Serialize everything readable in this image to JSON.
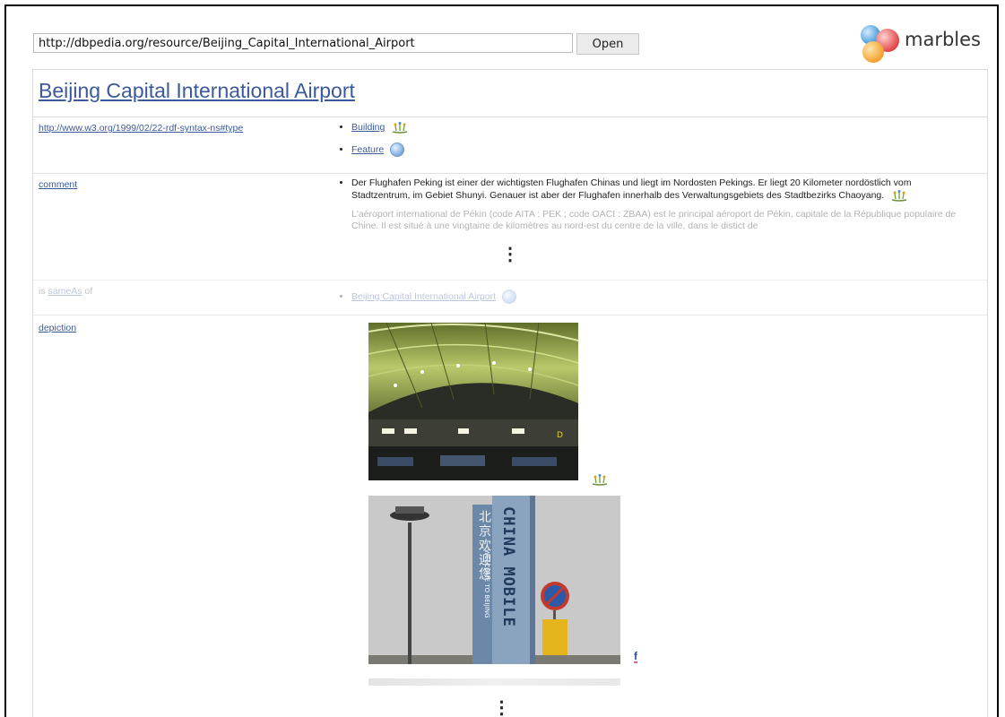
{
  "toolbar": {
    "url_value": "http://dbpedia.org/resource/Beijing_Capital_International_Airport",
    "open_label": "Open"
  },
  "logo": {
    "text": "marbles"
  },
  "resource": {
    "title": "Beijing Capital International Airport"
  },
  "rows": {
    "type": {
      "predicate": "http://www.w3.org/1999/02/22-rdf-syntax-ns#type",
      "values": [
        {
          "label": "Building",
          "icon": "building-source-icon"
        },
        {
          "label": "Feature",
          "icon": "globe-icon"
        }
      ]
    },
    "comment": {
      "predicate": "comment",
      "de_text": "Der Flughafen Peking ist einer der wichtigsten Flughafen Chinas und liegt im Nordosten Pekings. Er liegt 20 Kilometer nordöstlich vom Stadtzentrum, im Gebiet Shunyi. Genauer ist aber der Flughafen innerhalb des Verwaltungsgebiets des Stadtbezirks Chaoyang.",
      "fr_text": "L'aéroport international de Pékin (code AITA : PEK ; code OACI : ZBAA) est le principal aéroport de Pékin, capitale de la République populaire de Chine. Il est situé à une vingtaine de kilomètres au nord-est du centre de la ville, dans le distict de"
    },
    "sameas": {
      "prefix": "is",
      "link": "sameAs",
      "suffix": "of",
      "value": "Beijing Capital International Airport"
    },
    "depiction": {
      "predicate": "depiction",
      "sign_vertical_cn": "北京欢迎您",
      "sign_vertical_en": "CHINA MOBILE",
      "sign_welcome": "WELCOME TO BEIJING",
      "source_badge": "f"
    }
  },
  "ellipsis": "⋮",
  "colors": {
    "link": "#3c5a9a",
    "border": "#dcdcdc"
  }
}
